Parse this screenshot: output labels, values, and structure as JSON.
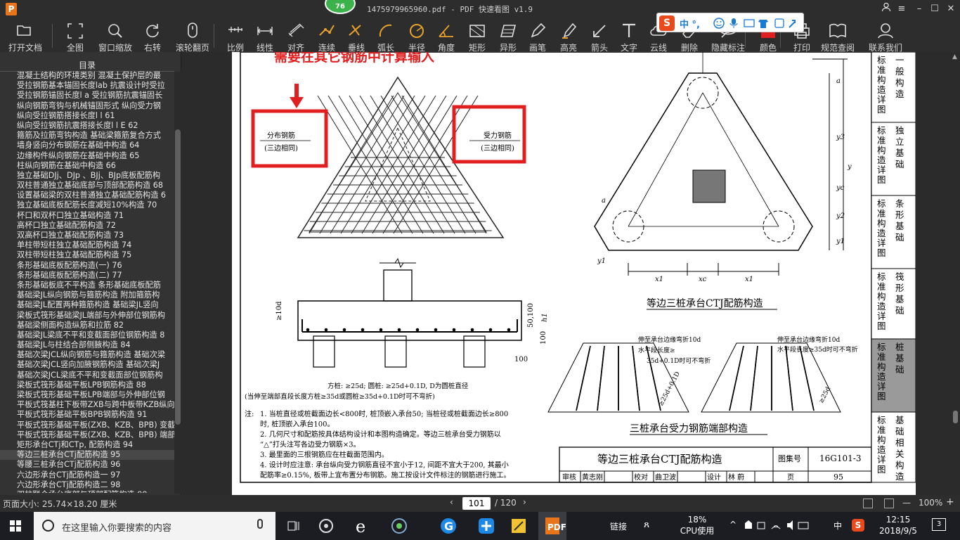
{
  "window": {
    "title": "1475979965960.pdf - PDF 快速看图 v1.9",
    "notification_count": "76"
  },
  "toolbar": {
    "items": [
      {
        "label": "打开文档",
        "icon": "folder-icon"
      },
      {
        "label": "全图",
        "icon": "fit-page-icon"
      },
      {
        "label": "窗口缩放",
        "icon": "zoom-icon"
      },
      {
        "label": "右转",
        "icon": "rotate-right-icon"
      },
      {
        "label": "滚轮翻页",
        "icon": "mouse-icon"
      },
      {
        "label": "比例",
        "icon": "scale-icon"
      },
      {
        "label": "线性",
        "icon": "linear-dim-icon"
      },
      {
        "label": "对齐",
        "icon": "aligned-dim-icon"
      },
      {
        "label": "连续",
        "icon": "continuous-dim-icon"
      },
      {
        "label": "垂线",
        "icon": "perpendicular-icon"
      },
      {
        "label": "弧长",
        "icon": "arc-length-icon"
      },
      {
        "label": "半径",
        "icon": "radius-icon"
      },
      {
        "label": "角度",
        "icon": "angle-icon"
      },
      {
        "label": "矩形",
        "icon": "rectangle-icon"
      },
      {
        "label": "异形",
        "icon": "polygon-icon"
      },
      {
        "label": "画笔",
        "icon": "pen-icon"
      },
      {
        "label": "高亮",
        "icon": "highlighter-icon"
      },
      {
        "label": "箭头",
        "icon": "arrow-icon"
      },
      {
        "label": "文字",
        "icon": "text-icon"
      },
      {
        "label": "云线",
        "icon": "cloud-icon"
      },
      {
        "label": "删除",
        "icon": "eraser-icon"
      },
      {
        "label": "隐藏标注",
        "icon": "hide-icon"
      },
      {
        "label": "颜色",
        "icon": "color-icon"
      },
      {
        "label": "打印",
        "icon": "print-icon"
      },
      {
        "label": "规范查阅",
        "icon": "book-icon"
      },
      {
        "label": "联系我们",
        "icon": "contact-icon"
      }
    ],
    "ime_text": "中 °,",
    "accent_red": "#e02020"
  },
  "sidebar": {
    "title": "目录",
    "items": [
      "混凝土结构的环境类别 混凝土保护层的最",
      "受拉钢筋基本锚固长度lab 抗震设计时受拉",
      "受拉钢筋锚固长度l a 受拉钢筋抗震锚固长",
      "纵向钢筋弯钩与机械锚固形式 纵向受力钢",
      "纵向受拉钢筋搭接长度l l 61",
      "纵向受拉钢筋抗震搭接长度l l E 62",
      "箍筋及拉筋弯钩构造 基础梁箍筋复合方式",
      "墙身竖向分布钢筋在基础中构造 64",
      "边缘构件纵向钢筋在基础中构造 65",
      "柱纵向钢筋在基础中构造 66",
      "独立基础DJj、DJp 、BJj、BJp底板配筋构",
      "双柱普通独立基础底部与顶部配筋构造 68",
      "设置基础梁的双柱普通独立基础配筋构造 6",
      "独立基础底板配筋长度减短10%构造 70",
      "杯口和双杯口独立基础构造 71",
      "高杯口独立基础配筋构造 72",
      "双高杯口独立基础配筋构造 73",
      "单柱带短柱独立基础配筋构造 74",
      "双柱带短柱独立基础配筋构造 75",
      "条形基础底板配筋构造(一) 76",
      "条形基础底板配筋构造(二) 77",
      "条形基础板底不平构造 条形基础底板配筋",
      "基础梁JL纵向钢筋与箍筋构造 附加箍筋构",
      "基础梁JL配置两种箍筋构造 基础梁JL竖向",
      "梁板式筏形基础梁JL端部与外伸部位钢筋构",
      "基础梁侧面构造纵筋和拉筋 82",
      "基础梁JL梁底不平和变截面部位钢筋构造 8",
      "基础梁JL与柱结合部侧腋构造 84",
      "基础次梁JCL纵向钢筋与箍筋构造 基础次梁",
      "基础次梁JCL竖向加腋钢筋构造 基础次梁J",
      "基础次梁JCL梁底不平和变截面部位钢筋构",
      "梁板式筏形基础平板LPB钢筋构造 88",
      "梁板式筏形基础平板LPB端部与外伸部位钢",
      "平板式筏基柱下板带ZXB与跨中板带KZB纵向",
      "平板式筏形基础平板BPB钢筋构造 91",
      "平板式筏形基础平板(ZXB、KZB、BPB) 变截",
      "平板式筏形基础平板(ZXB、KZB、BPB) 端部",
      "矩形承台CTj和CTp, 配筋构造 94",
      "等边三桩承台CTj配筋构造 95",
      "等腰三桩承台CTj配筋构造 96",
      "六边形承台CTj配筋构造一 97",
      "六边形承台CTj配筋构造二 98",
      "双柱联合承台底部与顶部配筋构造 99"
    ],
    "active_index": 38
  },
  "page": {
    "red_heading": "需要在其它钢筋中计算输入",
    "left_box_line1": "分布钢筋",
    "left_box_line2": "(三边相同)",
    "right_box_line1": "受力钢筋",
    "right_box_line2": "(三边相同)",
    "dim_10d": "≥10d",
    "dim_h1": "h1",
    "dim_50_100": "50,100",
    "dim_100": "100",
    "dim_100b": "100",
    "note_line1": "方桩: ≥25d; 圆桩: ≥25d+0.1D, D为圆桩直径",
    "note_line2": "(当伸至端部直段长度方桩≥35d或圆桩≥35d+0.1D时可不弯折)",
    "plan_title": "等边三桩承台CTJ配筋构造",
    "dims": {
      "a": "a",
      "y3": "y3",
      "y": "y",
      "yc": "yc",
      "y2": "y2",
      "y1": "y1",
      "x1": "x1",
      "xc": "xc"
    },
    "end_title": "三桩承台受力钢筋端部构造",
    "end_left_1": "伸至承台边缘弯折10d",
    "end_left_2": "水平段长度≥",
    "end_left_3": "35d+0.1D时可不弯折",
    "end_left_dim": "≥25d+0.1D",
    "end_right_1": "伸至承台边缘弯折10d",
    "end_right_2": "水平段长度≥35d时可不弯折",
    "end_right_dim": "≥25d",
    "notes_label": "注:",
    "notes": [
      "1. 当桩直径或桩截面边长<800时, 桩顶嵌入承台50; 当桩径或桩截面边长≥800",
      "   时, 桩顶嵌入承台100。",
      "2. 几何尺寸和配筋按具体结构设计和本图构造确定。等边三桩承台受力钢筋以",
      "   “△”打头注写各边受力钢筋×3。",
      "3. 最里面的三根钢筋应在柱截面范围内。",
      "4. 设计时应注意: 承台纵向受力钢筋直径不宜小于12, 间距不宜大于200, 其最小",
      "   配筋率≥0.15%, 板带上宜布置分布钢筋。施工按设计文件标注的钢筋进行施工。"
    ],
    "title_block": {
      "title": "等边三桩承台CTJ配筋构造",
      "atlas_label": "图集号",
      "atlas_no": "16G101-3",
      "row2": [
        "审核",
        "黄志刚",
        "校对",
        "曲卫波",
        "设计",
        "林 蔚",
        "页"
      ],
      "page_no": "95"
    },
    "side_tabs": [
      "标准构造详图 一般构造",
      "标准构造详图 独立基础",
      "标准构造详图 条形基础",
      "标准构造详图 筏形基础",
      "标准构造详图 桩基础",
      "标准构造详图 基础相关构造"
    ],
    "side_tab_active": 4
  },
  "status": {
    "page_size": "页面大小: 25.74×18.20 厘米",
    "current_page": "101",
    "total_pages": "/ 120",
    "zoom": "100%"
  },
  "taskbar": {
    "search_placeholder": "在这里输入你要搜索的内容",
    "link_label": "链接",
    "cpu_percent": "18%",
    "cpu_label": "CPU使用",
    "lang": "中",
    "time": "12:15",
    "date": "2018/9/5",
    "notif_count": "3"
  }
}
